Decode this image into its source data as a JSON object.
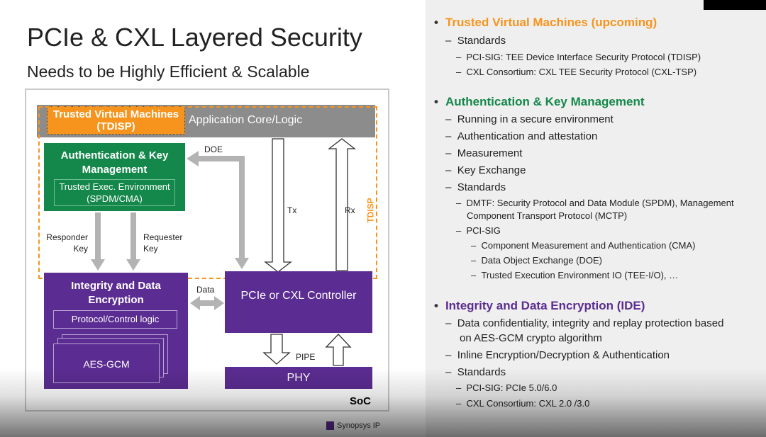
{
  "slide": {
    "title": "PCIe & CXL Layered Security",
    "subtitle": "Needs to be Highly Efficient & Scalable"
  },
  "diagram": {
    "tvm": "Trusted Virtual Machines (TDISP)",
    "app": "Application Core/Logic",
    "akm_title": "Authentication & Key Management",
    "tee": "Trusted Exec. Environment (SPDM/CMA)",
    "doe": "DOE",
    "tx": "Tx",
    "rx": "Rx",
    "tdisp": "TDISP",
    "responder": "Responder Key",
    "requester": "Requester Key",
    "ide_title": "Integrity and Data Encryption",
    "protocol": "Protocol/Control logic",
    "aes": "AES-GCM",
    "data": "Data",
    "controller": "PCIe or CXL Controller",
    "pipe": "PIPE",
    "phy": "PHY",
    "soc": "SoC",
    "legend": "Synopsys IP",
    "colors": {
      "orange": "#f7941d",
      "green": "#14874a",
      "purple": "#5b2c91",
      "gray": "#8c8c8c"
    }
  },
  "notes": {
    "s1": {
      "title": "Trusted Virtual Machines (upcoming)",
      "color": "#f7941d",
      "items": [
        "Standards",
        "PCI-SIG: TEE Device Interface Security Protocol (TDISP)",
        "CXL Consortium: CXL TEE Security Protocol (CXL-TSP)"
      ]
    },
    "s2": {
      "title": "Authentication & Key Management",
      "color": "#14874a",
      "items": [
        "Running in a secure environment",
        "Authentication and attestation",
        "Measurement",
        "Key Exchange",
        "Standards",
        "DMTF: Security Protocol and Data Module (SPDM), Management",
        "Component Transport Protocol (MCTP)",
        "PCI-SIG",
        "Component Measurement and Authentication (CMA)",
        "Data Object Exchange (DOE)",
        "Trusted Execution Environment IO (TEE-I/O), …"
      ]
    },
    "s3": {
      "title": "Integrity and Data Encryption (IDE)",
      "color": "#5b2c91",
      "items": [
        "Data confidentiality, integrity and replay protection based",
        "on AES-GCM crypto algorithm",
        "Inline Encryption/Decryption & Authentication",
        "Standards",
        "PCI-SIG: PCIe 5.0/6.0",
        "CXL Consortium: CXL 2.0 /3.0"
      ]
    }
  }
}
